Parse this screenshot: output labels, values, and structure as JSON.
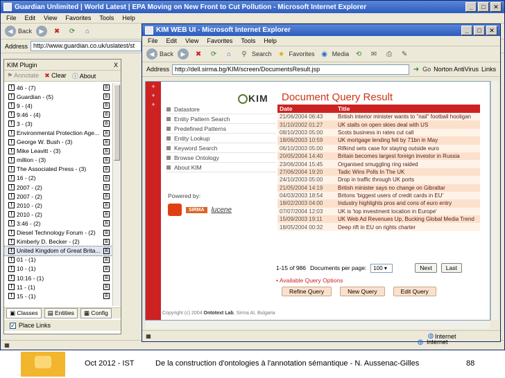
{
  "back_window": {
    "title": "Guardian Unlimited | World Latest | EPA Moving on New Front to Cut Pollution - Microsoft Internet Explorer",
    "menu": [
      "File",
      "Edit",
      "View",
      "Favorites",
      "Tools",
      "Help"
    ],
    "back_label": "Back",
    "address_label": "Address",
    "address": "http://www.guardian.co.uk/uslatest/st",
    "status": ""
  },
  "plugin": {
    "title": "KIM Plugin",
    "close": "X",
    "annotate": "Annotate",
    "clear": "Clear",
    "about": "About",
    "entities": [
      "46 - (7)",
      "Guardian - (5)",
      "9 - (4)",
      "9:46 - (4)",
      "3 - (3)",
      "Environmental Protection Age...",
      "George W. Bush - (3)",
      "Mike Leavitt - (3)",
      "million - (3)",
      "The Associated Press - (3)",
      "16 - (2)",
      "2007 - (2)",
      "2007 - (2)",
      "2010 - (2)",
      "2010 - (2)",
      "3:46 - (2)",
      "Diesel Technology Forum - (2)",
      "Kimberly D. Becker - (2)",
      "United Kingdom of Great Brita...",
      "01 - (1)",
      "10 - (1)",
      "10:16 - (1)",
      "11 - (1)",
      "15 - (1)"
    ],
    "tabs": [
      "Classes",
      "Entities",
      "Config"
    ],
    "place_links": "Place Links"
  },
  "front_window": {
    "title": "KIM WEB UI - Microsoft Internet Explorer",
    "menu": [
      "File",
      "Edit",
      "View",
      "Favorites",
      "Tools",
      "Help"
    ],
    "toolbar": {
      "back": "Back",
      "search": "Search",
      "favorites": "Favorites",
      "media": "Media"
    },
    "address_label": "Address",
    "address": "http://dell.sirma.bg/KIM/screen/DocumentsResult.jsp",
    "go": "Go",
    "norton": "Norton AntiVirus",
    "links": "Links",
    "status_zone": "Internet"
  },
  "kim": {
    "logo": "KIM",
    "page_title": "Document Query Result",
    "nav": [
      "Datastore",
      "Entity Pattern Search",
      "Predefined Patterns",
      "Entity Lookup",
      "Keyword Search",
      "Browse Ontology",
      "About KIM"
    ],
    "powered_by": "Powered by:",
    "sponsor_2": "SIRMA",
    "sponsor_3": "lucene",
    "columns": {
      "date": "Date",
      "title": "Title"
    },
    "results": [
      {
        "date": "21/06/2004 06:43",
        "title": "British interior minister wants to \"nail\" football hooligan"
      },
      {
        "date": "31/10/2002 01:27",
        "title": "UK stalls on open skies deal with US"
      },
      {
        "date": "08/10/2003 05:00",
        "title": "Scots business in rates cut call"
      },
      {
        "date": "18/06/2003 10:59",
        "title": "UK mortgage lending fell by 71bn in May"
      },
      {
        "date": "06/10/2003 05:00",
        "title": "Rifkind sets case for staying outside euro"
      },
      {
        "date": "20/05/2004 14:40",
        "title": "Britain becomes largest foreign investor in Russia"
      },
      {
        "date": "23/06/2004 15:45",
        "title": "Organised smuggling ring raided"
      },
      {
        "date": "27/06/2004 19:20",
        "title": "Tadic Wins Polls In The UK"
      },
      {
        "date": "24/10/2003 05:00",
        "title": "Drop in traffic through UK ports"
      },
      {
        "date": "21/05/2004 14:19",
        "title": "British minister says no change on Gibraltar"
      },
      {
        "date": "04/03/2003 18:54",
        "title": "Britons 'biggest users of credit cards in EU'"
      },
      {
        "date": "18/02/2003 04:00",
        "title": "Industry highlights pros and cons of euro entry"
      },
      {
        "date": "07/07/2004 12:03",
        "title": "UK is 'top investment location in Europe'"
      },
      {
        "date": "15/09/2003 19:11",
        "title": "UK Web Ad Revenues Up, Bucking Global Media Trend"
      },
      {
        "date": "18/05/2004 00:32",
        "title": "Deep rift in EU on rights charter"
      }
    ],
    "pager_text": "1-15 of 986",
    "docs_per_page_label": "Documents per page:",
    "docs_per_page": "100",
    "next": "Next",
    "last": "Last",
    "available_query": "Available Query Options",
    "refine": "Refine Query",
    "new_query": "New Query",
    "edit_query": "Edit Query",
    "copyright": "Copyright (c) 2004",
    "copyright_org": "Ontotext Lab",
    "copyright_rest": ", Sirma AI, Bulgaria"
  },
  "slide": {
    "date": "Oct 2012 - IST",
    "title": "De la construction d'ontologies à l'annotation sémantique - N. Aussenac-Gilles",
    "page": "88"
  }
}
